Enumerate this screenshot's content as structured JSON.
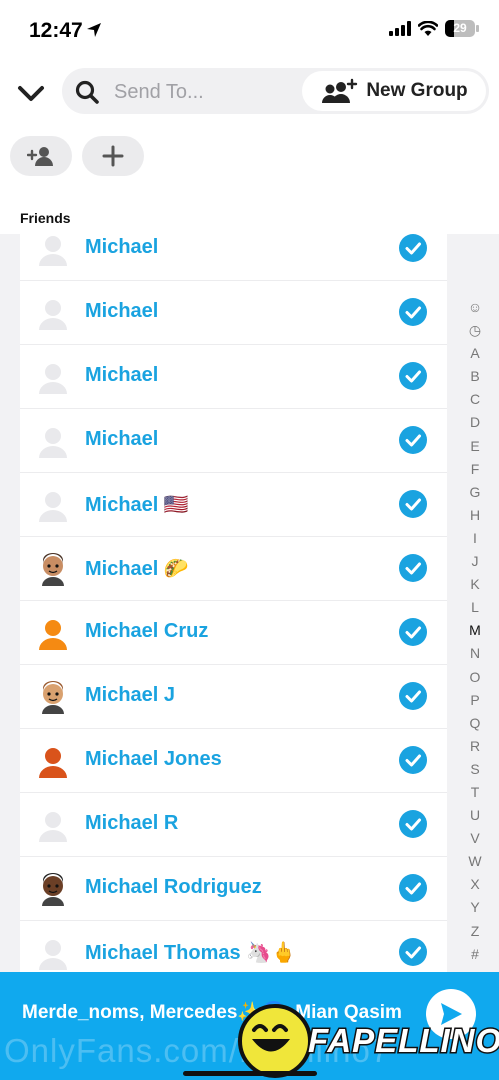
{
  "status": {
    "time": "12:47",
    "battery": "29"
  },
  "header": {
    "search": {
      "placeholder": "Send To..."
    },
    "new_group_label": "New Group",
    "chips": [
      "add-friend",
      "add"
    ],
    "section_title": "Friends"
  },
  "friends": [
    {
      "label": "Michael",
      "avatar": "ghost",
      "selected": true
    },
    {
      "label": "Michael",
      "avatar": "ghost",
      "selected": true
    },
    {
      "label": "Michael",
      "avatar": "ghost",
      "selected": true
    },
    {
      "label": "Michael",
      "avatar": "ghost",
      "selected": true
    },
    {
      "label": "Michael 🇺🇸",
      "avatar": "ghost",
      "selected": true
    },
    {
      "label": "Michael 🌮",
      "avatar": "bitmoji-glasses",
      "selected": true
    },
    {
      "label": "Michael Cruz",
      "avatar": "orange",
      "selected": true
    },
    {
      "label": "Michael J",
      "avatar": "bitmoji-beard",
      "selected": true
    },
    {
      "label": "Michael Jones",
      "avatar": "rust",
      "selected": true
    },
    {
      "label": "Michael R",
      "avatar": "ghost",
      "selected": true
    },
    {
      "label": "Michael Rodriguez",
      "avatar": "bitmoji-dark",
      "selected": true
    },
    {
      "label": "Michael Thomas 🦄🖕",
      "avatar": "ghost",
      "selected": true
    }
  ],
  "alpha_index": [
    "☺",
    "◷",
    "A",
    "B",
    "C",
    "D",
    "E",
    "F",
    "G",
    "H",
    "I",
    "J",
    "K",
    "L",
    "M",
    "N",
    "O",
    "P",
    "Q",
    "R",
    "S",
    "T",
    "U",
    "V",
    "W",
    "X",
    "Y",
    "Z",
    "#"
  ],
  "send_bar": {
    "names": "Merde_noms, Mercedes✨🌀, Mian Qasim"
  },
  "watermark": {
    "text": "OnlyFans.com/fapellino7",
    "logo": "FAPELLINO"
  },
  "colors": {
    "accent": "#1aa3e0",
    "send_bar": "#10a9ee"
  }
}
